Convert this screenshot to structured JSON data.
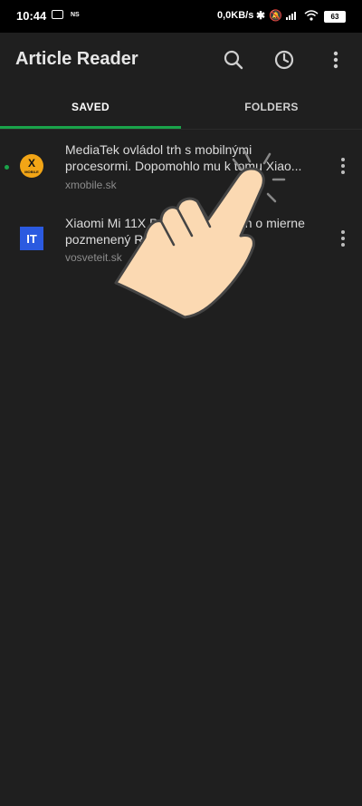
{
  "status_bar": {
    "time": "10:44",
    "ns": "NS",
    "network_speed": "0,0KB/s",
    "battery": "63"
  },
  "app_bar": {
    "title": "Article Reader",
    "icons": [
      "search-icon",
      "history-icon",
      "more-vert-icon"
    ]
  },
  "tabs": [
    {
      "label": "SAVED",
      "selected": true
    },
    {
      "label": "FOLDERS",
      "selected": false
    }
  ],
  "articles": [
    {
      "title": "MediaTek ovládol trh s mobilnými procesormi. Dopomohlo mu k tomu Xiao...",
      "source": "xmobile.sk",
      "icon_text": "X",
      "icon_subtext": "MOBILE",
      "unread": true
    },
    {
      "title": "Xiaomi Mi 11X Pro by mal byť len o mierne pozmenený Redmi K40 Pro+. ...",
      "source": "vosveteit.sk",
      "icon_text": "IT",
      "unread": false
    }
  ],
  "colors": {
    "accent": "#1aa34a",
    "background": "#1f1f1f",
    "status_bar": "#000000"
  }
}
